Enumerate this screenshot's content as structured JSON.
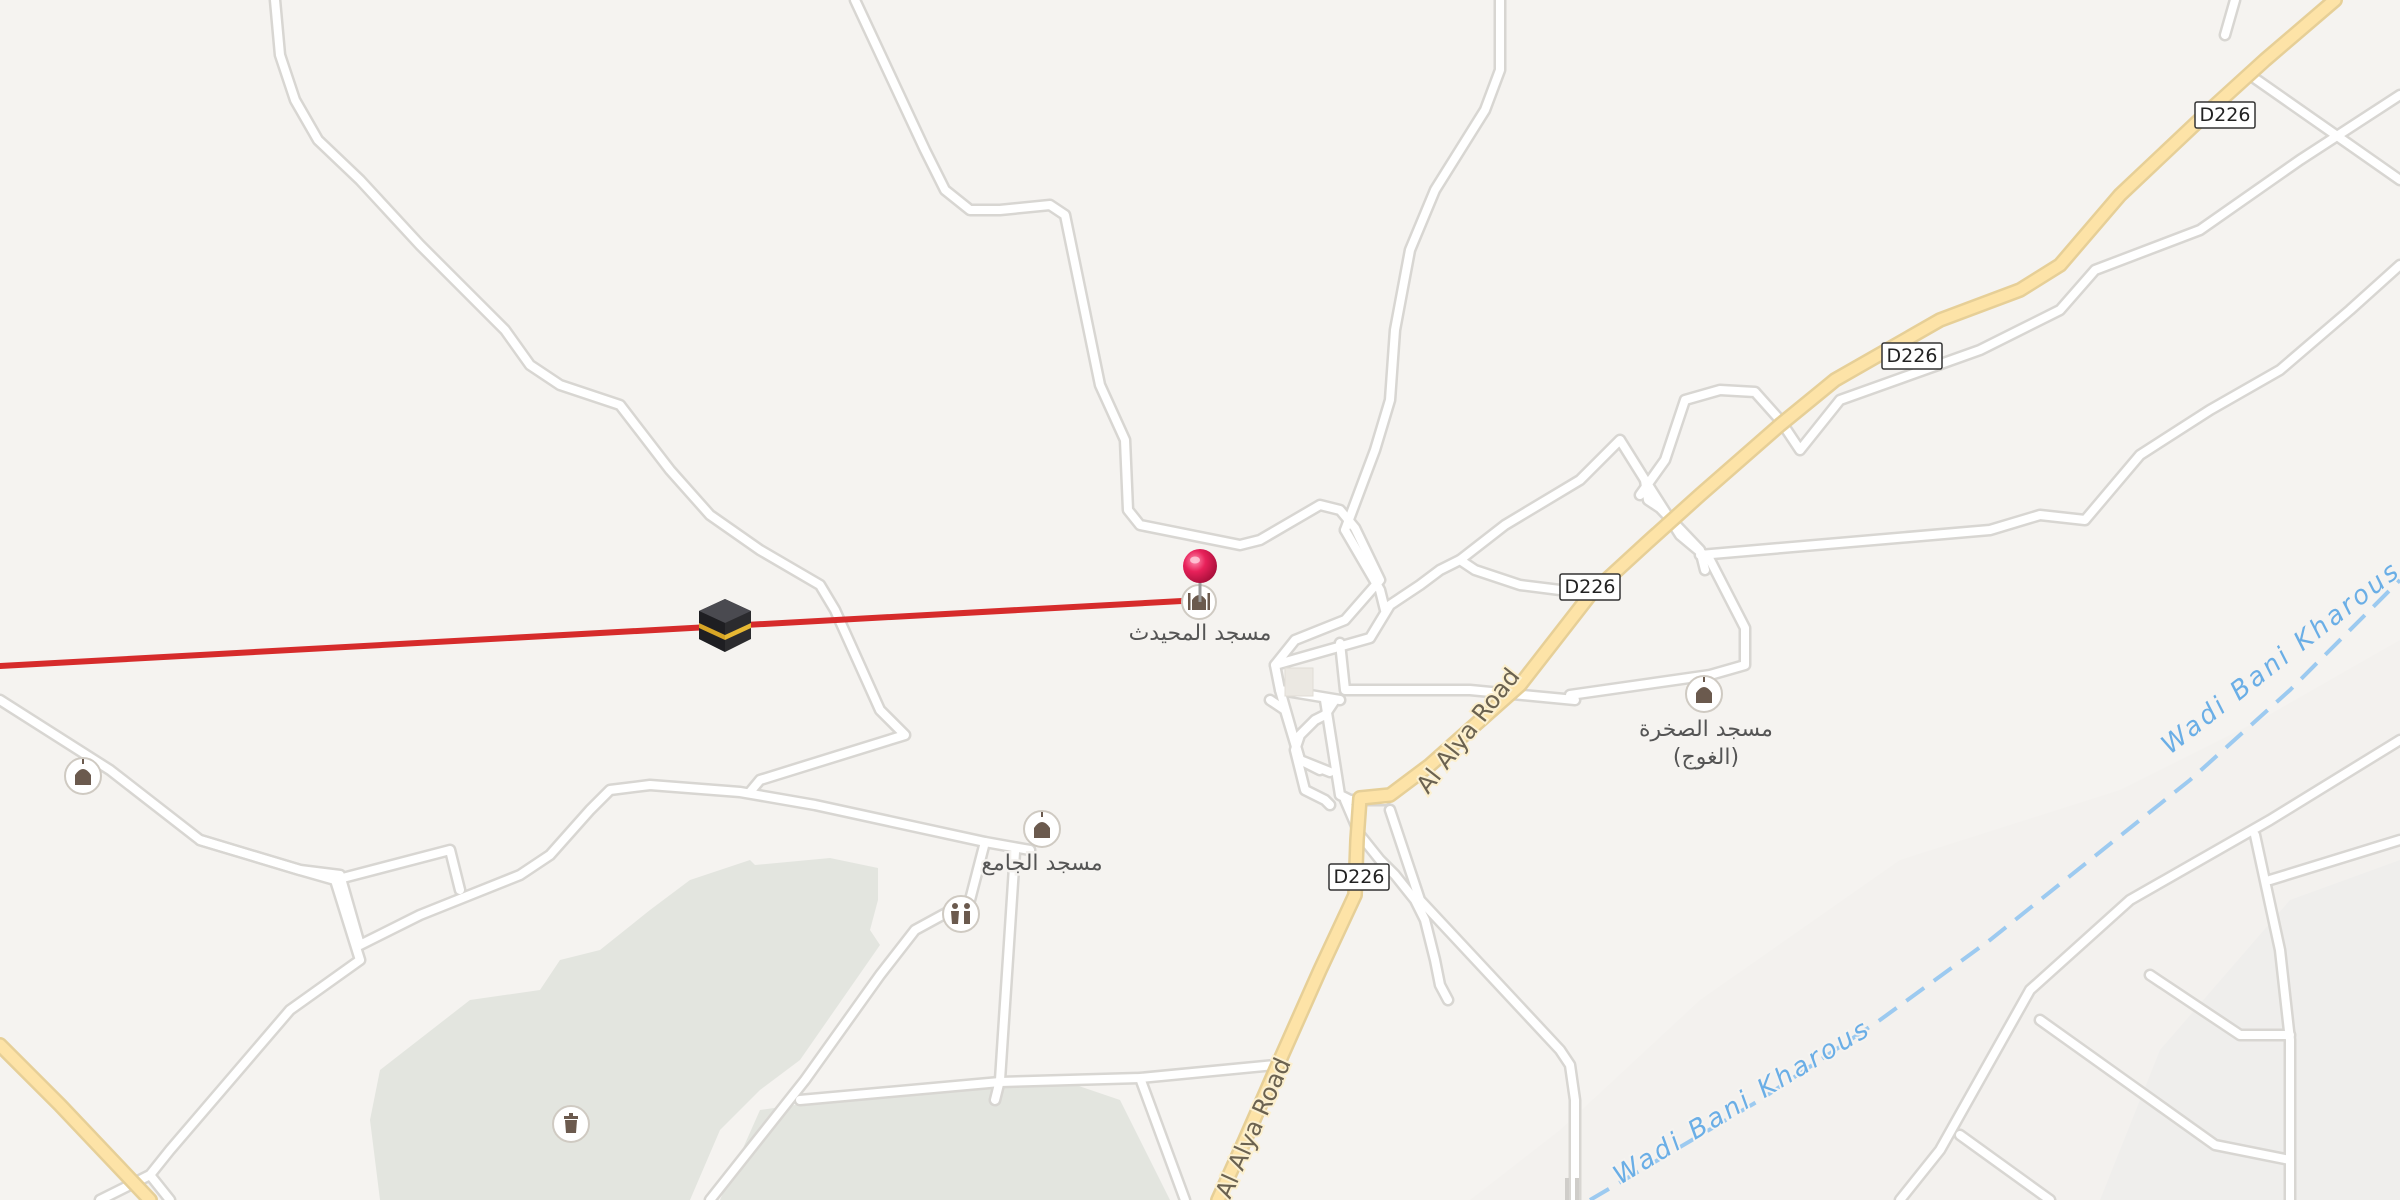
{
  "map": {
    "road_shields": [
      "D226",
      "D226",
      "D226",
      "D226"
    ],
    "road_names": [
      "Al Alya Road",
      "Al Alya Road"
    ],
    "waterway": "Wadi Bani Kharous",
    "pois": {
      "mosque_main": "مسجد المحيدث",
      "mosque_jami": "مسجد الجامع",
      "mosque_sakhra_line1": "مسجد الصخرة",
      "mosque_sakhra_line2": "(الغوج)"
    },
    "icons": {
      "pin": "map-pin-icon",
      "kaaba": "kaaba-icon",
      "mosque": "mosque-icon",
      "toilets": "toilets-icon",
      "waste": "waste-basket-icon"
    },
    "colors": {
      "background": "#f5f3f0",
      "minor_road": "#ffffff",
      "major_road": "#fde3a7",
      "qibla_line": "#d62b2b",
      "pin": "#e8215a",
      "park": "#e3e5df",
      "water": "#9ccaf0"
    }
  }
}
